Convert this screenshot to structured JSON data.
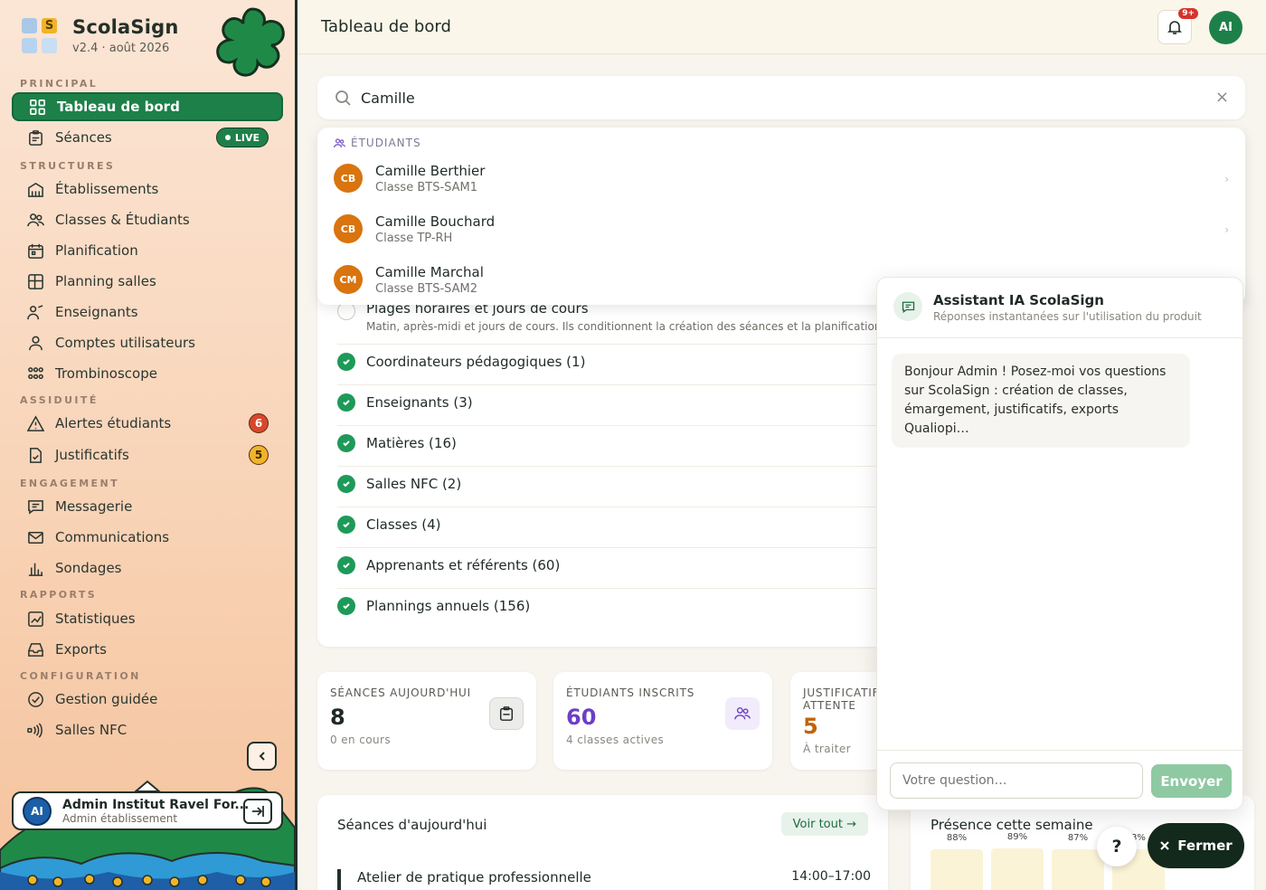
{
  "brand": {
    "name": "ScolaSign",
    "version": "v2.4 · août 2026"
  },
  "sidebar": {
    "sections": {
      "principal": "PRINCIPAL",
      "structures": "STRUCTURES",
      "assiduite": "ASSIDUITÉ",
      "engagement": "ENGAGEMENT",
      "rapports": "RAPPORTS",
      "configuration": "CONFIGURATION"
    },
    "items": {
      "dashboard": "Tableau de bord",
      "seances": "Séances",
      "live": "LIVE",
      "etablissements": "Établissements",
      "classes": "Classes & Étudiants",
      "planification": "Planification",
      "planning_salles": "Planning salles",
      "enseignants": "Enseignants",
      "comptes": "Comptes utilisateurs",
      "trombinoscope": "Trombinoscope",
      "alertes": "Alertes étudiants",
      "alertes_count": "6",
      "justificatifs": "Justificatifs",
      "justificatifs_count": "5",
      "messagerie": "Messagerie",
      "communications": "Communications",
      "sondages": "Sondages",
      "statistiques": "Statistiques",
      "exports": "Exports",
      "gestion_guidee": "Gestion guidée",
      "salles_nfc": "Salles NFC"
    }
  },
  "user": {
    "initials": "AI",
    "name": "Admin Institut Ravel For...",
    "role": "Admin établissement"
  },
  "topbar": {
    "title": "Tableau de bord",
    "notifications": "9+",
    "avatar": "AI"
  },
  "search": {
    "value": "Camille",
    "clear": "×"
  },
  "dropdown": {
    "heading": "ÉTUDIANTS",
    "results": [
      {
        "initials": "CB",
        "name": "Camille Berthier",
        "class": "Classe BTS-SAM1"
      },
      {
        "initials": "CB",
        "name": "Camille Bouchard",
        "class": "Classe TP-RH"
      },
      {
        "initials": "CM",
        "name": "Camille Marchal",
        "class": "Classe BTS-SAM2"
      }
    ]
  },
  "setup": {
    "first": {
      "title": "Plages horaires et jours de cours",
      "desc": "Matin, après-midi et jours de cours. Ils conditionnent la création des séances et la planification"
    },
    "steps": [
      "Coordinateurs pédagogiques (1)",
      "Enseignants (3)",
      "Matières (16)",
      "Salles NFC (2)",
      "Classes (4)",
      "Apprenants et référents (60)",
      "Plannings annuels (156)"
    ]
  },
  "stats": [
    {
      "label": "SÉANCES AUJOURD'HUI",
      "value": "8",
      "sub": "0 en cours"
    },
    {
      "label": "ÉTUDIANTS INSCRITS",
      "value": "60",
      "sub": "4 classes actives"
    },
    {
      "label": "JUSTIFICATIF",
      "label2": "ATTENTE",
      "value": "5",
      "sub": "À traiter"
    }
  ],
  "today": {
    "title": "Séances d'aujourd'hui",
    "see_all": "Voir tout →",
    "session": "Atelier de pratique professionnelle",
    "time": "14:00–17:00"
  },
  "presence": {
    "title": "Présence cette semaine",
    "labels": [
      "88%",
      "89%",
      "87%",
      "3%"
    ]
  },
  "assistant": {
    "title": "Assistant IA ScolaSign",
    "subtitle": "Réponses instantanées sur l'utilisation du produit",
    "message": "Bonjour Admin ! Posez-moi vos questions sur ScolaSign : création de classes, émargement, justificatifs, exports Qualiopi…",
    "placeholder": "Votre question…",
    "send": "Envoyer"
  },
  "help": "?",
  "close": "Fermer",
  "colors": {
    "accent": "#1e8049",
    "orange": "#d9740e",
    "purple": "#6c3fc4",
    "badge_red": "#d9472b",
    "badge_yellow": "#f0b429"
  }
}
